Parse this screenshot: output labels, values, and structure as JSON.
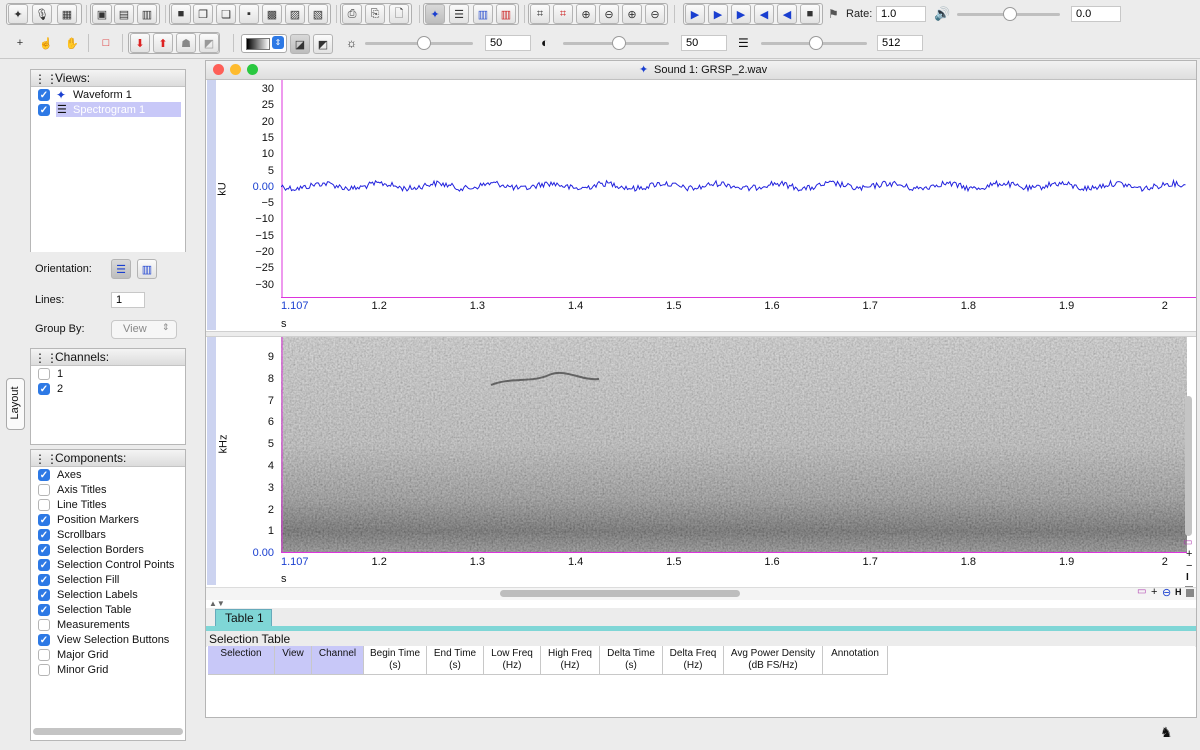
{
  "toolbar": {
    "rate_label": "Rate:",
    "rate_value": "1.0",
    "volume_value": "0.0",
    "brightness_value": "50",
    "contrast_value": "50",
    "resolution_value": "512"
  },
  "window": {
    "title": "Sound 1: GRSP_2.wav"
  },
  "side_tab": "Layout",
  "views_panel": {
    "title": "Views:",
    "items": [
      {
        "label": "Waveform 1",
        "checked": true
      },
      {
        "label": "Spectrogram 1",
        "checked": true,
        "selected": true
      }
    ],
    "orientation_label": "Orientation:",
    "lines_label": "Lines:",
    "lines_value": "1",
    "group_by_label": "Group By:",
    "group_by_value": "View"
  },
  "channels_panel": {
    "title": "Channels:",
    "items": [
      {
        "label": "1",
        "checked": false
      },
      {
        "label": "2",
        "checked": true
      }
    ]
  },
  "components_panel": {
    "title": "Components:",
    "items": [
      {
        "label": "Axes",
        "checked": true
      },
      {
        "label": "Axis Titles",
        "checked": false
      },
      {
        "label": "Line Titles",
        "checked": false
      },
      {
        "label": "Position Markers",
        "checked": true
      },
      {
        "label": "Scrollbars",
        "checked": true
      },
      {
        "label": "Selection Borders",
        "checked": true
      },
      {
        "label": "Selection Control Points",
        "checked": true
      },
      {
        "label": "Selection Fill",
        "checked": true
      },
      {
        "label": "Selection Labels",
        "checked": true
      },
      {
        "label": "Selection Table",
        "checked": true
      },
      {
        "label": "Measurements",
        "checked": false
      },
      {
        "label": "View Selection Buttons",
        "checked": true
      },
      {
        "label": "Major Grid",
        "checked": false
      },
      {
        "label": "Minor Grid",
        "checked": false
      }
    ]
  },
  "waveform": {
    "y_axis_label": "kU",
    "y_ticks": [
      "30",
      "25",
      "20",
      "15",
      "10",
      "5",
      "0.00",
      "−5",
      "−10",
      "−15",
      "−20",
      "−25",
      "−30"
    ],
    "x_ticks": [
      "1.107",
      "1.2",
      "1.3",
      "1.4",
      "1.5",
      "1.6",
      "1.7",
      "1.8",
      "1.9",
      "2"
    ],
    "x_unit": "s",
    "line_color": "#2222dd"
  },
  "spectrogram": {
    "y_axis_label": "kHz",
    "y_ticks": [
      "9",
      "8",
      "7",
      "6",
      "5",
      "4",
      "3",
      "2",
      "1",
      "0.00"
    ],
    "x_ticks": [
      "1.107",
      "1.2",
      "1.3",
      "1.4",
      "1.5",
      "1.6",
      "1.7",
      "1.8",
      "1.9",
      "2"
    ],
    "x_unit": "s"
  },
  "table_tab": {
    "tab_label": "Table 1",
    "section_title": "Selection Table",
    "columns": [
      {
        "line1": "Selection",
        "line2": ""
      },
      {
        "line1": "View",
        "line2": ""
      },
      {
        "line1": "Channel",
        "line2": ""
      },
      {
        "line1": "Begin Time",
        "line2": "(s)"
      },
      {
        "line1": "End Time",
        "line2": "(s)"
      },
      {
        "line1": "Low Freq",
        "line2": "(Hz)"
      },
      {
        "line1": "High Freq",
        "line2": "(Hz)"
      },
      {
        "line1": "Delta Time",
        "line2": "(s)"
      },
      {
        "line1": "Delta Freq",
        "line2": "(Hz)"
      },
      {
        "line1": "Avg Power Density",
        "line2": "(dB FS/Hz)"
      },
      {
        "line1": "Annotation",
        "line2": ""
      }
    ]
  },
  "colors": {
    "accent_blue": "#2d79e5",
    "selection_row": "#c8c8f8",
    "tab_teal": "#7fd6d6",
    "marker_magenta": "#dd33dd"
  }
}
